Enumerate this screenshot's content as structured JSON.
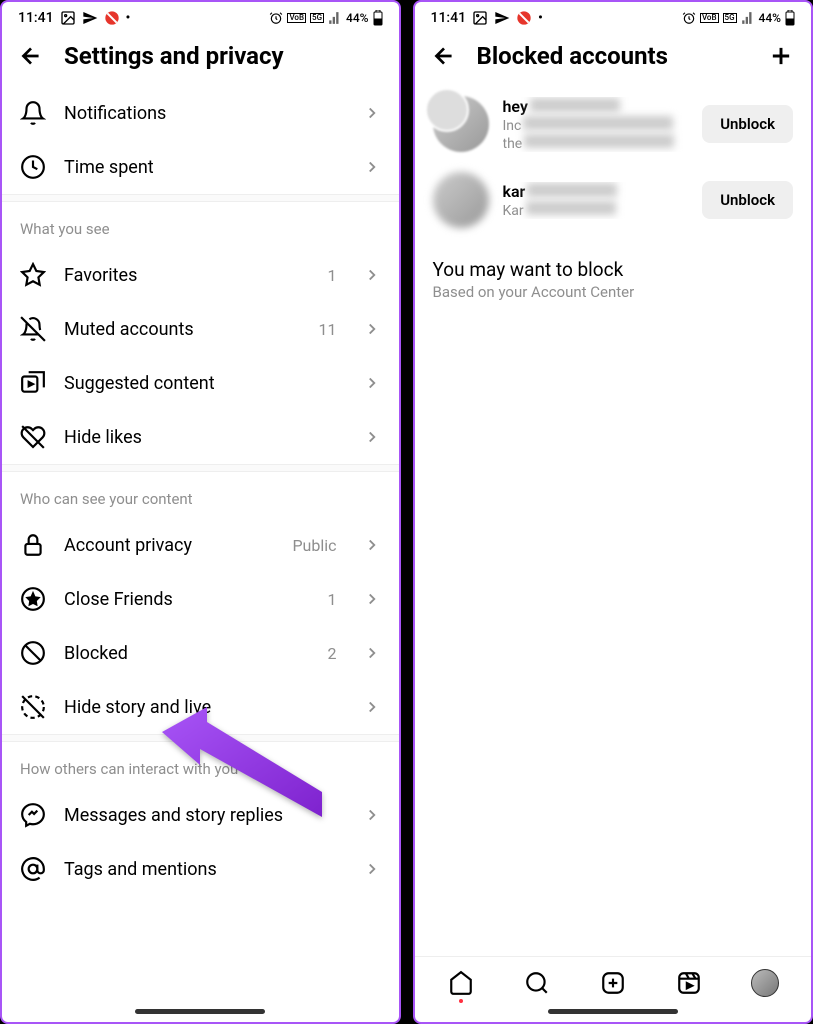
{
  "status": {
    "time": "11:41",
    "battery": "44%",
    "badges": [
      "VoB",
      "5G"
    ]
  },
  "left": {
    "title": "Settings and privacy",
    "top_rows": [
      {
        "icon": "bell",
        "label": "Notifications"
      },
      {
        "icon": "clock",
        "label": "Time spent"
      }
    ],
    "sections": [
      {
        "label": "What you see",
        "rows": [
          {
            "icon": "star",
            "label": "Favorites",
            "value": "1"
          },
          {
            "icon": "bell-off",
            "label": "Muted accounts",
            "value": "11"
          },
          {
            "icon": "suggested",
            "label": "Suggested content"
          },
          {
            "icon": "heart-off",
            "label": "Hide likes"
          }
        ]
      },
      {
        "label": "Who can see your content",
        "rows": [
          {
            "icon": "lock",
            "label": "Account privacy",
            "value": "Public"
          },
          {
            "icon": "circle-star",
            "label": "Close Friends",
            "value": "1"
          },
          {
            "icon": "block",
            "label": "Blocked",
            "value": "2"
          },
          {
            "icon": "story-off",
            "label": "Hide story and live"
          }
        ]
      },
      {
        "label": "How others can interact with you",
        "rows": [
          {
            "icon": "messenger",
            "label": "Messages and story replies"
          },
          {
            "icon": "at",
            "label": "Tags and mentions"
          }
        ]
      }
    ]
  },
  "right": {
    "title": "Blocked accounts",
    "accounts": [
      {
        "name_prefix": "hey",
        "desc_prefix": "Inc",
        "desc2_prefix": "the"
      },
      {
        "name_prefix": "kar",
        "desc_prefix": "Kar"
      }
    ],
    "unblock_label": "Unblock",
    "suggest_title": "You may want to block",
    "suggest_sub": "Based on your Account Center"
  },
  "overlay": {
    "arrow_color": "#9333ea"
  }
}
